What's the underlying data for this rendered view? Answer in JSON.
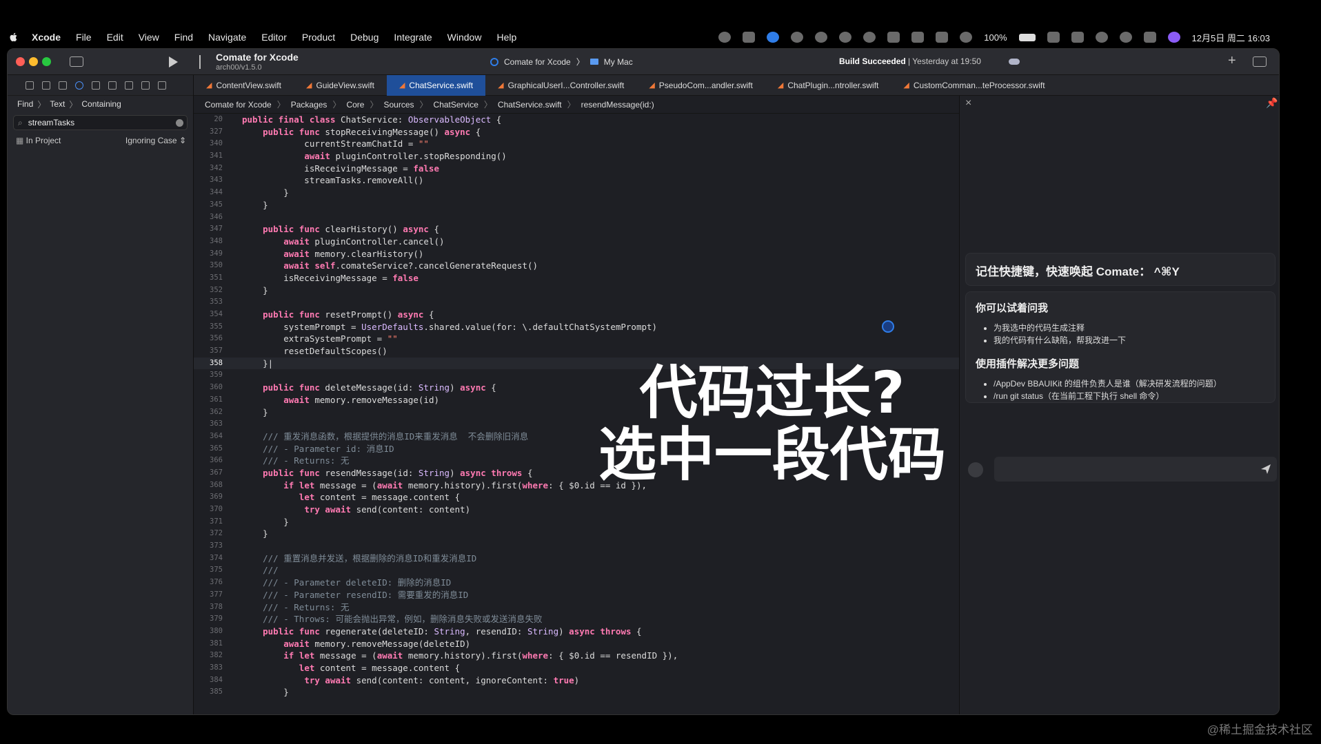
{
  "menubar": {
    "items": [
      "Xcode",
      "File",
      "Edit",
      "View",
      "Find",
      "Navigate",
      "Editor",
      "Product",
      "Debug",
      "Integrate",
      "Window",
      "Help"
    ],
    "battery": "100%",
    "datetime": "12月5日 周二 16:03"
  },
  "window": {
    "project_title": "Comate for Xcode",
    "project_subtitle": "arch00/v1.5.0",
    "scheme": "Comate for Xcode",
    "destination": "My Mac",
    "build_status_bold": "Build Succeeded",
    "build_status_time": "Yesterday at 19:50"
  },
  "navigator": {
    "breadcrumb": [
      "Find",
      "Text",
      "Containing"
    ],
    "search_value": "streamTasks",
    "scope": "In Project",
    "case": "Ignoring Case"
  },
  "tabs": [
    "ContentView.swift",
    "GuideView.swift",
    "ChatService.swift",
    "GraphicalUserI...Controller.swift",
    "PseudoCom...andler.swift",
    "ChatPlugin...ntroller.swift",
    "CustomComman...teProcessor.swift"
  ],
  "active_tab": "ChatService.swift",
  "jumpbar": [
    "Comate for Xcode",
    "Packages",
    "Core",
    "Sources",
    "ChatService",
    "ChatService.swift",
    "resendMessage(id:)"
  ],
  "code": [
    {
      "n": "20",
      "t": "public final class ChatService: ObservableObject {"
    },
    {
      "n": "327",
      "t": "    public func stopReceivingMessage() async {"
    },
    {
      "n": "340",
      "t": "            currentStreamChatId = \"\""
    },
    {
      "n": "341",
      "t": "            await pluginController.stopResponding()"
    },
    {
      "n": "342",
      "t": "            isReceivingMessage = false"
    },
    {
      "n": "343",
      "t": "            streamTasks.removeAll()"
    },
    {
      "n": "344",
      "t": "        }"
    },
    {
      "n": "345",
      "t": "    }"
    },
    {
      "n": "346",
      "t": ""
    },
    {
      "n": "347",
      "t": "    public func clearHistory() async {"
    },
    {
      "n": "348",
      "t": "        await pluginController.cancel()"
    },
    {
      "n": "349",
      "t": "        await memory.clearHistory()"
    },
    {
      "n": "350",
      "t": "        await self.comateService?.cancelGenerateRequest()"
    },
    {
      "n": "351",
      "t": "        isReceivingMessage = false"
    },
    {
      "n": "352",
      "t": "    }"
    },
    {
      "n": "353",
      "t": ""
    },
    {
      "n": "354",
      "t": "    public func resetPrompt() async {"
    },
    {
      "n": "355",
      "t": "        systemPrompt = UserDefaults.shared.value(for: \\.defaultChatSystemPrompt)"
    },
    {
      "n": "356",
      "t": "        extraSystemPrompt = \"\""
    },
    {
      "n": "357",
      "t": "        resetDefaultScopes()"
    },
    {
      "n": "358",
      "t": "    }|"
    },
    {
      "n": "359",
      "t": ""
    },
    {
      "n": "360",
      "t": "    public func deleteMessage(id: String) async {"
    },
    {
      "n": "361",
      "t": "        await memory.removeMessage(id)"
    },
    {
      "n": "362",
      "t": "    }"
    },
    {
      "n": "363",
      "t": ""
    },
    {
      "n": "364",
      "t": "    /// 重发消息函数，根据提供的消息ID来重发消息  不会删除旧消息"
    },
    {
      "n": "365",
      "t": "    /// - Parameter id: 消息ID"
    },
    {
      "n": "366",
      "t": "    /// - Returns: 无"
    },
    {
      "n": "367",
      "t": "    public func resendMessage(id: String) async throws {"
    },
    {
      "n": "368",
      "t": "        if let message = (await memory.history).first(where: { $0.id == id }),"
    },
    {
      "n": "369",
      "t": "           let content = message.content {"
    },
    {
      "n": "370",
      "t": "            try await send(content: content)"
    },
    {
      "n": "371",
      "t": "        }"
    },
    {
      "n": "372",
      "t": "    }"
    },
    {
      "n": "373",
      "t": ""
    },
    {
      "n": "374",
      "t": "    /// 重置消息并发送，根据删除的消息ID和重发消息ID"
    },
    {
      "n": "375",
      "t": "    ///"
    },
    {
      "n": "376",
      "t": "    /// - Parameter deleteID: 删除的消息ID"
    },
    {
      "n": "377",
      "t": "    /// - Parameter resendID: 需要重发的消息ID"
    },
    {
      "n": "378",
      "t": "    /// - Returns: 无"
    },
    {
      "n": "379",
      "t": "    /// - Throws: 可能会抛出异常，例如，删除消息失败或发送消息失败"
    },
    {
      "n": "380",
      "t": "    public func regenerate(deleteID: String, resendID: String) async throws {"
    },
    {
      "n": "381",
      "t": "        await memory.removeMessage(deleteID)"
    },
    {
      "n": "382",
      "t": "        if let message = (await memory.history).first(where: { $0.id == resendID }),"
    },
    {
      "n": "383",
      "t": "           let content = message.content {"
    },
    {
      "n": "384",
      "t": "            try await send(content: content, ignoreContent: true)"
    },
    {
      "n": "385",
      "t": "        }"
    }
  ],
  "current_line": "358",
  "comate": {
    "shortcut_tip": "记住快捷键，快速唤起 Comate： ^⌘Y",
    "try_title": "你可以试着问我",
    "try_items": [
      "为我选中的代码生成注释",
      "我的代码有什么缺陷，帮我改进一下"
    ],
    "plugin_title": "使用插件解决更多问题",
    "plugin_items": [
      "/AppDev BBAUIKit 的组件负责人是谁（解决研发流程的问题）",
      "/run git status（在当前工程下执行 shell 命令）"
    ]
  },
  "overlay": {
    "line1": "代码过长?",
    "line2": "选中一段代码"
  },
  "watermark": "@稀土掘金技术社区",
  "colors": {
    "keyword": "#ff7ab2",
    "type": "#dabaff",
    "function": "#67b7a4",
    "comment": "#7f8c98",
    "string": "#ff8170",
    "accent": "#1f4f9a"
  }
}
